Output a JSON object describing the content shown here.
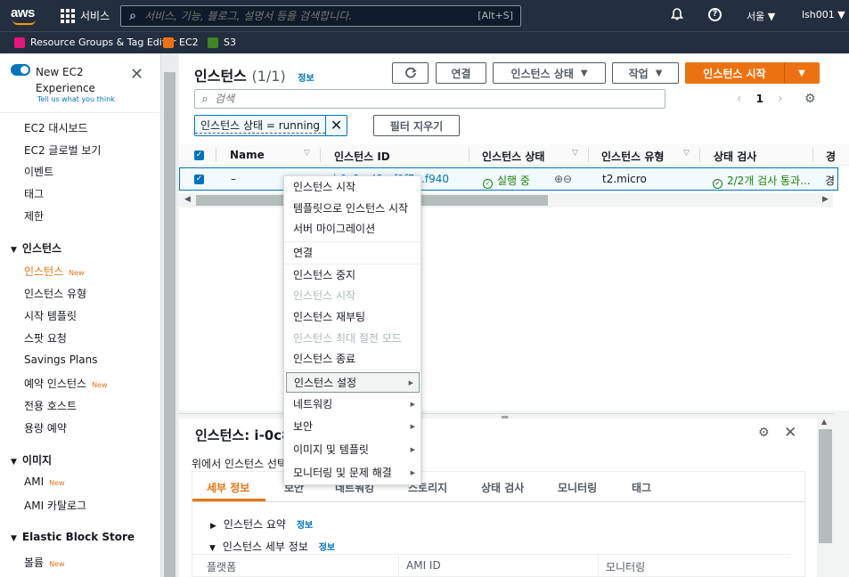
{
  "topnav": {
    "logo_text": "aws",
    "services_label": "서비스",
    "search_placeholder": "서비스, 기능, 블로그, 설명서 등을 검색합니다.",
    "search_shortcut": "[Alt+S]",
    "help_glyph": "?",
    "region_label": "서울 ▼",
    "user_label": "lsh001 ▼"
  },
  "favorites": [
    {
      "label": "Resource Groups & Tag Editor",
      "color": "#e7157b"
    },
    {
      "label": "EC2",
      "color": "#ec7211"
    },
    {
      "label": "S3",
      "color": "#3f8624"
    }
  ],
  "sidebar": {
    "new_experience": "New EC2 Experience",
    "tell_us": "Tell us what you think",
    "close_glyph": "✕",
    "top_items": [
      "EC2 대시보드",
      "EC2 글로벌 보기",
      "이벤트",
      "태그",
      "제한"
    ],
    "instances_header": "인스턴스",
    "instances_items": [
      {
        "label": "인스턴스",
        "badge": "New",
        "active": true
      },
      {
        "label": "인스턴스 유형",
        "badge": ""
      },
      {
        "label": "시작 템플릿",
        "badge": ""
      },
      {
        "label": "스팟 요청",
        "badge": ""
      },
      {
        "label": "Savings Plans",
        "badge": ""
      },
      {
        "label": "예약 인스턴스",
        "badge": "New"
      },
      {
        "label": "전용 호스트",
        "badge": ""
      },
      {
        "label": "용량 예약",
        "badge": ""
      }
    ],
    "images_header": "이미지",
    "images_items": [
      {
        "label": "AMI",
        "badge": "New"
      },
      {
        "label": "AMI 카탈로그",
        "badge": ""
      }
    ],
    "ebs_header": "Elastic Block Store",
    "ebs_items": [
      {
        "label": "볼륨",
        "badge": "New"
      }
    ]
  },
  "main": {
    "title": "인스턴스",
    "count": "(1/1)",
    "info_link": "정보",
    "buttons": {
      "connect": "연결",
      "state": "인스턴스 상태",
      "actions": "작업",
      "launch": "인스턴스 시작"
    },
    "filter_placeholder": "검색",
    "page_number": "1",
    "chip_text": "인스턴스 상태 = running",
    "chip_remove_glyph": "✕",
    "clear_filters": "필터 지우기",
    "columns": [
      "Name",
      "인스턴스 ID",
      "인스턴스 상태",
      "인스턴스 유형",
      "상태 검사",
      "경"
    ],
    "row": {
      "name": "–",
      "instance_id": "i-0c8...42...f9f7...f940",
      "state": "실행 중",
      "type": "t2.micro",
      "status_check": "2/2개 검사 통과...",
      "alarm": "경"
    }
  },
  "detail": {
    "title": "인스턴스: i-0c8",
    "subtitle": "위에서 인스턴스 선택",
    "tabs": [
      "세부 정보",
      "보안",
      "네트워킹",
      "스토리지",
      "상태 검사",
      "모니터링",
      "태그"
    ],
    "sections": [
      "인스턴스 요약",
      "인스턴스 세부 정보"
    ],
    "info_link": "정보",
    "fields": [
      "플랫폼",
      "AMI ID",
      "모니터링"
    ]
  },
  "context_menu": {
    "items": [
      {
        "label": "인스턴스 시작",
        "disabled": false
      },
      {
        "label": "템플릿으로 인스턴스 시작",
        "disabled": false
      },
      {
        "label": "서버 마이그레이션",
        "disabled": false
      },
      {
        "label": "연결",
        "disabled": false
      },
      {
        "label": "인스턴스 중지",
        "disabled": false
      },
      {
        "label": "인스턴스 시작",
        "disabled": true
      },
      {
        "label": "인스턴스 재부팅",
        "disabled": false
      },
      {
        "label": "인스턴스 최대 절전 모드",
        "disabled": true
      },
      {
        "label": "인스턴스 종료",
        "disabled": false
      },
      {
        "label": "인스턴스 설정",
        "submenu": true,
        "highlighted": true
      },
      {
        "label": "네트워킹",
        "submenu": true
      },
      {
        "label": "보안",
        "submenu": true
      },
      {
        "label": "이미지 및 템플릿",
        "submenu": true
      },
      {
        "label": "모니터링 및 문제 해결",
        "submenu": true
      }
    ]
  },
  "colors": {
    "nav_bg": "#232f3e",
    "accent": "#ec7211",
    "link": "#0073bb",
    "success": "#1d8102"
  }
}
